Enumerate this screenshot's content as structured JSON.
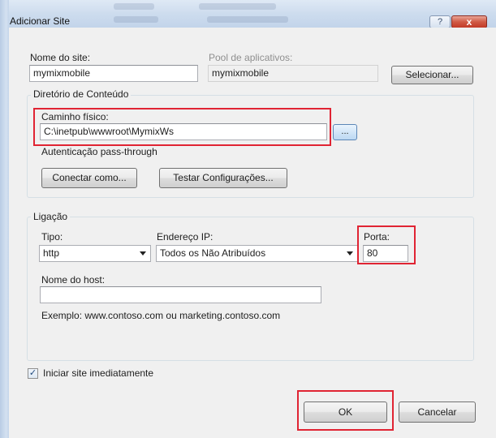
{
  "window": {
    "title": "Adicionar Site",
    "help_glyph": "?",
    "close_glyph": "x"
  },
  "site": {
    "name_label": "Nome do site:",
    "name_value": "mymixmobile",
    "pool_label": "Pool de aplicativos:",
    "pool_value": "mymixmobile",
    "select_button": "Selecionar..."
  },
  "content_dir": {
    "group_title": "Diretório de Conteúdo",
    "path_label": "Caminho físico:",
    "path_value": "C:\\inetpub\\wwwroot\\MymixWs",
    "browse_button": "...",
    "auth_label": "Autenticação pass-through",
    "connect_as_button": "Conectar como...",
    "test_settings_button": "Testar Configurações..."
  },
  "binding": {
    "group_title": "Ligação",
    "type_label": "Tipo:",
    "type_value": "http",
    "ip_label": "Endereço IP:",
    "ip_value": "Todos os Não Atribuídos",
    "port_label": "Porta:",
    "port_value": "80",
    "host_label": "Nome do host:",
    "host_value": "",
    "example_text": "Exemplo: www.contoso.com ou marketing.contoso.com"
  },
  "start_immediately": {
    "label": "Iniciar site imediatamente",
    "checked": true,
    "check_glyph": "✓"
  },
  "footer": {
    "ok_button": "OK",
    "cancel_button": "Cancelar"
  },
  "colors": {
    "highlight": "#e02433",
    "close_button": "#c23b28",
    "titlebar": "#cddcee"
  }
}
